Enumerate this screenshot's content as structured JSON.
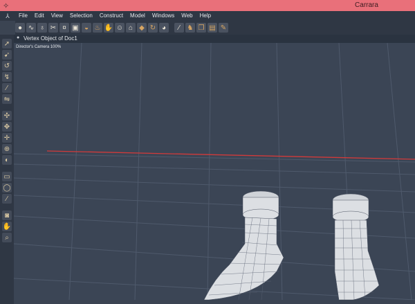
{
  "window": {
    "title": "Carrara"
  },
  "menu": [
    "File",
    "Edit",
    "View",
    "Selection",
    "Construct",
    "Model",
    "Windows",
    "Web",
    "Help"
  ],
  "toolbar_icons": [
    "sphere-icon",
    "spline-icon",
    "vase-icon",
    "scissors-icon",
    "pin-icon",
    "frame-icon",
    "dome-icon",
    "lamp-icon",
    "hand-icon",
    "face-icon",
    "label-icon",
    "cube-icon",
    "rotate-icon",
    "ball-icon",
    "wand-icon",
    "figure-icon",
    "box-icon",
    "film-icon",
    "camera-icon"
  ],
  "left_tools": [
    "arrow-icon",
    "move-icon",
    "spin-icon",
    "curl-icon",
    "knife-icon",
    "arrows-icon",
    "scale-icon",
    "bone-icon",
    "target-icon",
    "shield-icon",
    "rect-select-icon",
    "lasso-icon",
    "brush-icon",
    "camera-icon",
    "hand-icon",
    "zoom-icon"
  ],
  "view": {
    "title": "Vertex Object of Doc1",
    "camera_label": "Director's Camera 100%"
  },
  "colors": {
    "titlebar": "#e9707a",
    "background": "#3b4555",
    "grid_line": "#566074",
    "axis_line": "#d23a3a",
    "mesh": "#e6e7e8"
  }
}
